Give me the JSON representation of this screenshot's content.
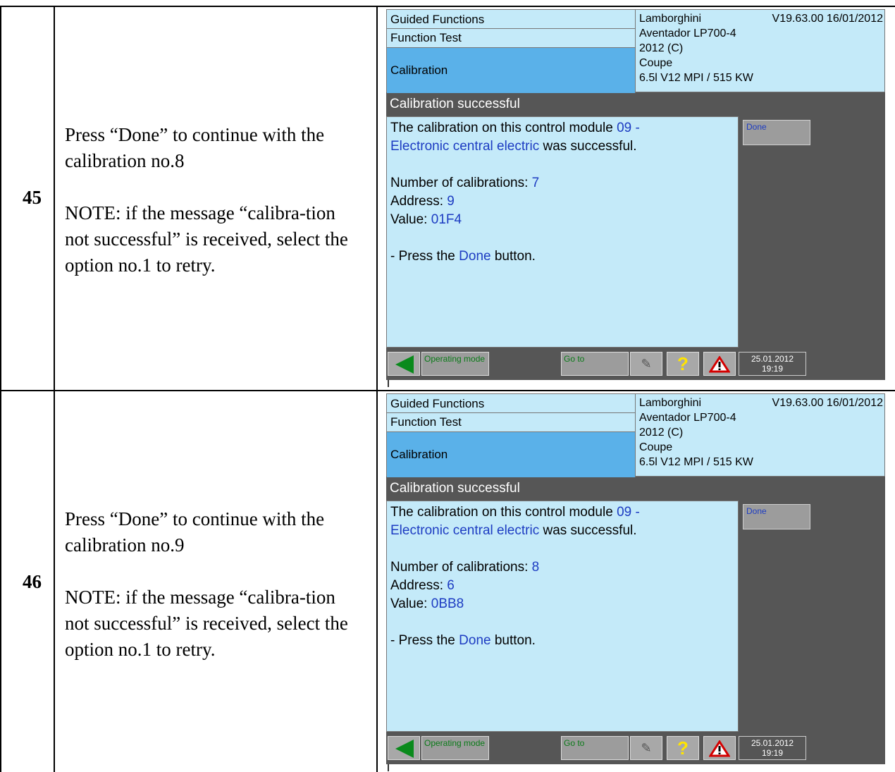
{
  "rows": [
    {
      "number": "45",
      "instruction": "Press “Done” to continue with the calibration no.8",
      "note": "NOTE: if the message “calibra-tion not successful” is received, select the option no.1 to retry.",
      "screen": {
        "header": {
          "guided_functions": "Guided Functions",
          "function_test": "Function Test",
          "calibration": "Calibration",
          "make": "Lamborghini",
          "version": "V19.63.00 16/01/2012",
          "model": "Aventador LP700-4",
          "year": "2012 (C)",
          "body": "Coupe",
          "engine": "6.5l V12 MPI / 515 KW"
        },
        "title": "Calibration successful",
        "msg_pre": "The calibration on this control module ",
        "module_code": "09  -",
        "module_name": "Electronic central electric",
        "msg_post": "  was successful.",
        "count_label": "Number of calibrations: ",
        "count_value": "7",
        "address_label": "Address: ",
        "address_value": "9",
        "value_label": "Value: ",
        "value_value": "01F4",
        "press_pre": "- Press the ",
        "press_button": "Done",
        "press_post": " button.",
        "done_button": "Done",
        "operating_mode": "Operating mode",
        "goto": "Go to",
        "date": "25.01.2012",
        "time": "19:19"
      }
    },
    {
      "number": "46",
      "instruction": "Press “Done” to continue with the calibration no.9",
      "note": "NOTE: if the message “calibra-tion not successful” is received, select the option no.1 to retry.",
      "screen": {
        "header": {
          "guided_functions": "Guided Functions",
          "function_test": "Function Test",
          "calibration": "Calibration",
          "make": "Lamborghini",
          "version": "V19.63.00 16/01/2012",
          "model": "Aventador LP700-4",
          "year": "2012 (C)",
          "body": "Coupe",
          "engine": "6.5l V12 MPI / 515 KW"
        },
        "title": "Calibration successful",
        "msg_pre": "The calibration on this control module ",
        "module_code": "09  -",
        "module_name": "Electronic central electric",
        "msg_post": "  was successful.",
        "count_label": "Number of calibrations: ",
        "count_value": "8",
        "address_label": "Address: ",
        "address_value": "6",
        "value_label": "Value: ",
        "value_value": "0BB8",
        "press_pre": "- Press the ",
        "press_button": "Done",
        "press_post": " button.",
        "done_button": "Done",
        "operating_mode": "Operating mode",
        "goto": "Go to",
        "date": "25.01.2012",
        "time": "19:19"
      }
    }
  ],
  "colors": {
    "panel_bg": "#c4eaf9",
    "highlight_tab": "#5ab1e9",
    "screen_bg": "#565656",
    "link_blue": "#1d3cc2",
    "back_arrow": "#0a8a1c"
  }
}
